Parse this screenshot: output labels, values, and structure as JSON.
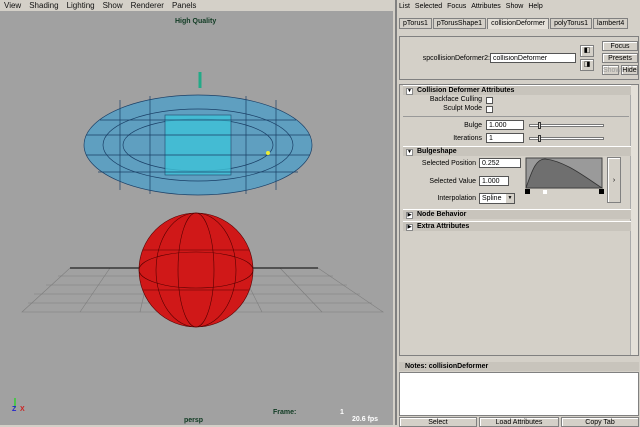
{
  "viewport": {
    "menu": [
      "View",
      "Shading",
      "Lighting",
      "Show",
      "Renderer",
      "Panels"
    ],
    "quality": "High Quality",
    "frame_label": "Frame:",
    "frame_value": "1",
    "camera": "persp",
    "fps": "20.6 fps",
    "axis": {
      "x": "X",
      "y": "Y",
      "z": "Z"
    }
  },
  "attr_editor": {
    "menu": [
      "List",
      "Selected",
      "Focus",
      "Attributes",
      "Show",
      "Help"
    ],
    "tabs": [
      "pTorus1",
      "pTorusShape1",
      "collisionDeformer",
      "polyTorus1",
      "lambert4"
    ],
    "active_tab": 2,
    "node_label": "spcollisionDeformer2:",
    "node_value": "collisionDeformer",
    "focus": "Focus",
    "presets": "Presets",
    "show": "Show",
    "hide": "Hide",
    "sections": {
      "collision": "Collision Deformer Attributes",
      "bulgeshape": "Bulgeshape",
      "node_behavior": "Node Behavior",
      "extra": "Extra Attributes"
    },
    "backface_culling": {
      "label": "Backface Culling",
      "checked": false
    },
    "sculpt_mode": {
      "label": "Sculpt Mode",
      "checked": false
    },
    "bulge": {
      "label": "Bulge",
      "value": "1.000"
    },
    "iterations": {
      "label": "Iterations",
      "value": "1"
    },
    "selected_position": {
      "label": "Selected Position",
      "value": "0.252"
    },
    "selected_value": {
      "label": "Selected Value",
      "value": "1.000"
    },
    "interpolation": {
      "label": "Interpolation",
      "value": "Spline"
    },
    "notes_label": "Notes:  collisionDeformer",
    "buttons": [
      "Select",
      "Load Attributes",
      "Copy Tab"
    ]
  }
}
